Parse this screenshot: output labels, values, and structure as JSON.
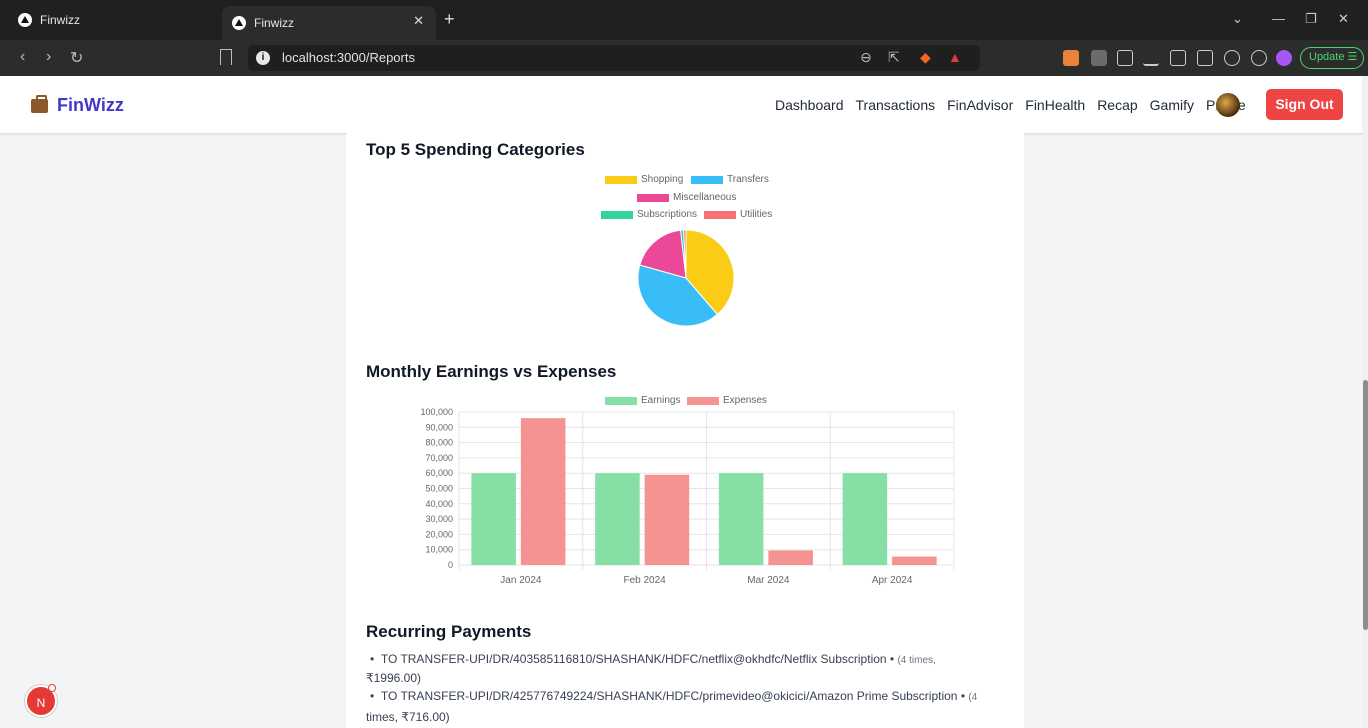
{
  "browser": {
    "tabs": [
      {
        "title": "Finwizz"
      },
      {
        "title": "Finwizz"
      }
    ],
    "url": "localhost:3000/Reports",
    "update_label": "Update"
  },
  "app": {
    "brand": "FinWizz",
    "nav": [
      "Dashboard",
      "Transactions",
      "FinAdvisor",
      "FinHealth",
      "Recap",
      "Gamify",
      "Profile"
    ],
    "signout_label": "Sign Out"
  },
  "sections": {
    "pie_title": "Top 5 Spending Categories",
    "bar_title": "Monthly Earnings vs Expenses",
    "recurring_title": "Recurring Payments"
  },
  "recurring": [
    {
      "text": "TO TRANSFER-UPI/DR/403585116810/SHASHANK/HDFC/netflix@okhdfc/Netflix Subscription",
      "meta_a": "(4 times,",
      "meta_b": "₹1996.00)"
    },
    {
      "text": "TO TRANSFER-UPI/DR/425776749224/SHASHANK/HDFC/primevideo@okicici/Amazon Prime Subscription",
      "meta_a": "(4",
      "meta_b": "times, ₹716.00)"
    }
  ],
  "chart_data": [
    {
      "type": "pie",
      "title": "Top 5 Spending Categories",
      "legend": [
        "Shopping",
        "Transfers",
        "Miscellaneous",
        "Subscriptions",
        "Utilities"
      ],
      "colors": [
        "#facc15",
        "#38bdf8",
        "#ec4899",
        "#34d399",
        "#f87171"
      ],
      "values": [
        39,
        41,
        19,
        1,
        0.8
      ],
      "legend_position": "top"
    },
    {
      "type": "bar",
      "title": "Monthly Earnings vs Expenses",
      "categories": [
        "Jan 2024",
        "Feb 2024",
        "Mar 2024",
        "Apr 2024"
      ],
      "series": [
        {
          "name": "Earnings",
          "color": "#86e0a5",
          "values": [
            60000,
            60000,
            60000,
            60000
          ]
        },
        {
          "name": "Expenses",
          "color": "#f59393",
          "values": [
            96000,
            59000,
            9500,
            5500
          ]
        }
      ],
      "yticks": [
        "100,000",
        "90,000",
        "80,000",
        "70,000",
        "60,000",
        "50,000",
        "40,000",
        "30,000",
        "20,000",
        "10,000",
        "0"
      ],
      "ylim": [
        0,
        100000
      ],
      "grid": true,
      "legend_position": "top"
    }
  ],
  "dev_badge": "N"
}
